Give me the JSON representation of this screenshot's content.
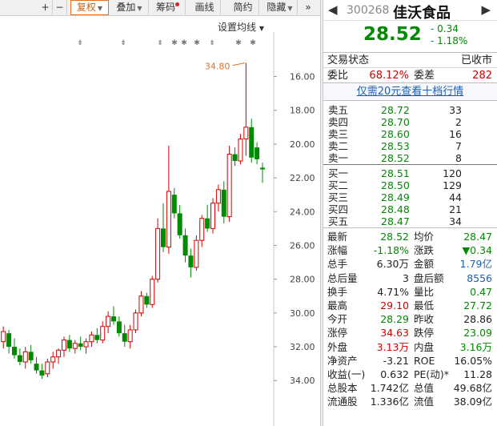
{
  "toolbar": {
    "plus": "+",
    "minus": "−",
    "fuquan": "复权",
    "diejia": "叠加",
    "chouma": "筹码",
    "huaxian": "画线",
    "jianyue": "简约",
    "yincang": "隐藏",
    "expand": "»"
  },
  "chart": {
    "ma_label": "设置均线",
    "peak_label": "34.80",
    "y_ticks": [
      "34.00",
      "32.00",
      "30.00",
      "28.00",
      "26.00",
      "24.00",
      "22.00",
      "20.00",
      "18.00",
      "16.00"
    ],
    "colors": {
      "up": "#d00000",
      "down": "#008a00"
    }
  },
  "chart_data": {
    "type": "candlestick",
    "ylim": [
      15.3,
      35.4
    ],
    "y_ticks": [
      16,
      18,
      20,
      22,
      24,
      26,
      28,
      30,
      32,
      34
    ],
    "candles": [
      {
        "o": 18.3,
        "h": 19.2,
        "l": 17.9,
        "c": 18.9
      },
      {
        "o": 18.8,
        "h": 19.0,
        "l": 17.6,
        "c": 18.0
      },
      {
        "o": 18.0,
        "h": 18.5,
        "l": 17.3,
        "c": 17.5
      },
      {
        "o": 17.5,
        "h": 17.9,
        "l": 16.9,
        "c": 17.1
      },
      {
        "o": 17.1,
        "h": 18.0,
        "l": 16.7,
        "c": 17.7
      },
      {
        "o": 17.7,
        "h": 18.1,
        "l": 17.0,
        "c": 17.2
      },
      {
        "o": 17.0,
        "h": 17.4,
        "l": 16.4,
        "c": 16.6
      },
      {
        "o": 16.6,
        "h": 17.0,
        "l": 16.1,
        "c": 16.3
      },
      {
        "o": 16.4,
        "h": 17.3,
        "l": 16.2,
        "c": 17.1
      },
      {
        "o": 17.1,
        "h": 17.7,
        "l": 16.7,
        "c": 17.4
      },
      {
        "o": 17.4,
        "h": 17.9,
        "l": 17.0,
        "c": 17.8
      },
      {
        "o": 17.8,
        "h": 18.6,
        "l": 17.4,
        "c": 18.4
      },
      {
        "o": 18.4,
        "h": 18.7,
        "l": 17.7,
        "c": 17.9
      },
      {
        "o": 17.9,
        "h": 18.4,
        "l": 17.6,
        "c": 18.2
      },
      {
        "o": 18.2,
        "h": 18.6,
        "l": 17.8,
        "c": 18.0
      },
      {
        "o": 18.0,
        "h": 18.5,
        "l": 17.6,
        "c": 18.3
      },
      {
        "o": 18.3,
        "h": 18.9,
        "l": 18.0,
        "c": 18.7
      },
      {
        "o": 18.7,
        "h": 19.1,
        "l": 18.2,
        "c": 18.4
      },
      {
        "o": 18.4,
        "h": 19.5,
        "l": 18.2,
        "c": 19.2
      },
      {
        "o": 19.2,
        "h": 20.1,
        "l": 18.8,
        "c": 19.8
      },
      {
        "o": 19.8,
        "h": 20.4,
        "l": 19.3,
        "c": 19.5
      },
      {
        "o": 19.5,
        "h": 19.8,
        "l": 18.6,
        "c": 18.8
      },
      {
        "o": 18.8,
        "h": 19.3,
        "l": 18.0,
        "c": 18.3
      },
      {
        "o": 18.3,
        "h": 19.3,
        "l": 17.9,
        "c": 19.0
      },
      {
        "o": 19.0,
        "h": 20.2,
        "l": 18.8,
        "c": 20.0
      },
      {
        "o": 20.0,
        "h": 21.3,
        "l": 19.8,
        "c": 21.0
      },
      {
        "o": 21.0,
        "h": 21.2,
        "l": 20.3,
        "c": 20.5
      },
      {
        "o": 20.5,
        "h": 22.2,
        "l": 20.3,
        "c": 22.0
      },
      {
        "o": 22.0,
        "h": 25.6,
        "l": 21.8,
        "c": 25.0
      },
      {
        "o": 25.0,
        "h": 26.5,
        "l": 23.6,
        "c": 23.9
      },
      {
        "o": 23.9,
        "h": 29.9,
        "l": 23.5,
        "c": 27.2
      },
      {
        "o": 27.0,
        "h": 27.4,
        "l": 25.6,
        "c": 25.9
      },
      {
        "o": 25.9,
        "h": 26.4,
        "l": 24.4,
        "c": 24.6
      },
      {
        "o": 24.6,
        "h": 25.0,
        "l": 23.0,
        "c": 23.4
      },
      {
        "o": 23.4,
        "h": 23.8,
        "l": 22.1,
        "c": 22.7
      },
      {
        "o": 22.7,
        "h": 24.6,
        "l": 22.5,
        "c": 24.3
      },
      {
        "o": 24.3,
        "h": 25.8,
        "l": 23.9,
        "c": 25.6
      },
      {
        "o": 25.6,
        "h": 26.4,
        "l": 24.8,
        "c": 25.0
      },
      {
        "o": 25.0,
        "h": 26.8,
        "l": 24.7,
        "c": 26.5
      },
      {
        "o": 26.5,
        "h": 27.6,
        "l": 26.0,
        "c": 27.3
      },
      {
        "o": 27.3,
        "h": 27.8,
        "l": 25.3,
        "c": 25.7
      },
      {
        "o": 25.7,
        "h": 29.9,
        "l": 25.4,
        "c": 29.4
      },
      {
        "o": 29.4,
        "h": 29.8,
        "l": 28.7,
        "c": 29.0
      },
      {
        "o": 29.0,
        "h": 30.6,
        "l": 28.8,
        "c": 30.3
      },
      {
        "o": 30.3,
        "h": 34.8,
        "l": 29.3,
        "c": 31.0
      },
      {
        "o": 31.0,
        "h": 31.5,
        "l": 28.9,
        "c": 29.2
      },
      {
        "o": 29.8,
        "h": 30.1,
        "l": 28.8,
        "c": 29.1
      },
      {
        "o": 28.6,
        "h": 28.9,
        "l": 27.7,
        "c": 28.5
      }
    ]
  },
  "header": {
    "prev": "◀",
    "next": "▶",
    "code": "300268",
    "name": "佳沃食品"
  },
  "quote": {
    "price": "28.52",
    "change": "- 0.34",
    "pct": "- 1.18%"
  },
  "status": {
    "label": "交易状态",
    "value": "已收市"
  },
  "wei": {
    "webi_label": "委比",
    "webi": "68.12%",
    "wecha_label": "委差",
    "wecha": "282"
  },
  "upsell": "仅需20元查看十档行情",
  "sell": [
    {
      "label": "卖五",
      "price": "28.72",
      "vol": "33"
    },
    {
      "label": "卖四",
      "price": "28.70",
      "vol": "2"
    },
    {
      "label": "卖三",
      "price": "28.60",
      "vol": "16"
    },
    {
      "label": "卖二",
      "price": "28.53",
      "vol": "7"
    },
    {
      "label": "卖一",
      "price": "28.52",
      "vol": "8"
    }
  ],
  "buy": [
    {
      "label": "买一",
      "price": "28.51",
      "vol": "120"
    },
    {
      "label": "买二",
      "price": "28.50",
      "vol": "129"
    },
    {
      "label": "买三",
      "price": "28.49",
      "vol": "44"
    },
    {
      "label": "买四",
      "price": "28.48",
      "vol": "21"
    },
    {
      "label": "买五",
      "price": "28.47",
      "vol": "34"
    }
  ],
  "stats": [
    {
      "l1": "最新",
      "v1": "28.52",
      "c1": "green",
      "l2": "均价",
      "v2": "28.47",
      "c2": "green"
    },
    {
      "l1": "涨幅",
      "v1": "-1.18%",
      "c1": "green",
      "l2": "涨跌",
      "v2": "▼0.34",
      "c2": "green"
    },
    {
      "l1": "总手",
      "v1": "6.30万",
      "c1": "",
      "l2": "金额",
      "v2": "1.79亿",
      "c2": "blue"
    },
    {
      "l1": "总后量",
      "v1": "3",
      "c1": "",
      "l2": "盘后额",
      "v2": "8556",
      "c2": "blue"
    },
    {
      "l1": "换手",
      "v1": "4.71%",
      "c1": "",
      "l2": "量比",
      "v2": "0.47",
      "c2": "green"
    },
    {
      "l1": "最高",
      "v1": "29.10",
      "c1": "red",
      "l2": "最低",
      "v2": "27.72",
      "c2": "green"
    },
    {
      "l1": "今开",
      "v1": "28.29",
      "c1": "green",
      "l2": "昨收",
      "v2": "28.86",
      "c2": ""
    },
    {
      "l1": "涨停",
      "v1": "34.63",
      "c1": "red",
      "l2": "跌停",
      "v2": "23.09",
      "c2": "green"
    },
    {
      "l1": "外盘",
      "v1": "3.13万",
      "c1": "red",
      "l2": "内盘",
      "v2": "3.16万",
      "c2": "green"
    },
    {
      "l1": "净资产",
      "v1": "-3.21",
      "c1": "",
      "l2": "ROE",
      "v2": "16.05%",
      "c2": ""
    },
    {
      "l1": "收益(一)",
      "v1": "0.632",
      "c1": "",
      "l2": "PE(动)*",
      "v2": "11.28",
      "c2": ""
    },
    {
      "l1": "总股本",
      "v1": "1.742亿",
      "c1": "",
      "l2": "总值",
      "v2": "49.68亿",
      "c2": ""
    },
    {
      "l1": "流通股",
      "v1": "1.336亿",
      "c1": "",
      "l2": "流值",
      "v2": "38.09亿",
      "c2": ""
    }
  ]
}
